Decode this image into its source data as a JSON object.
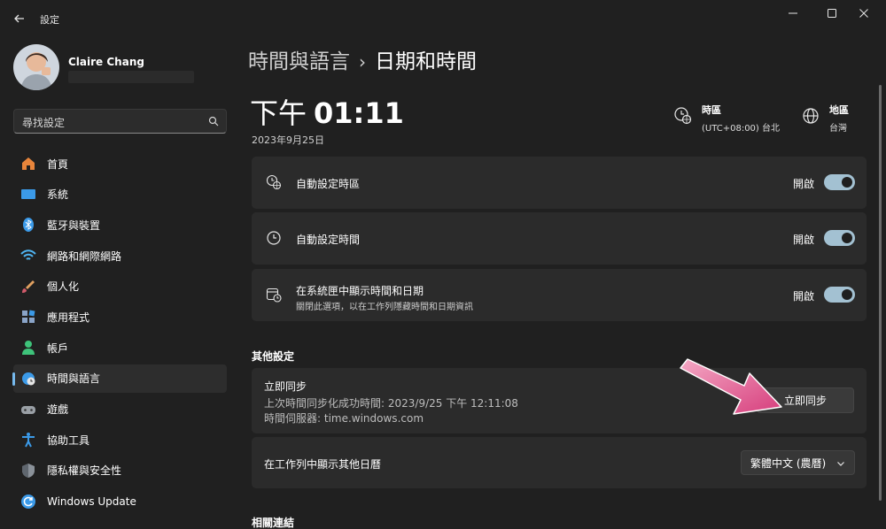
{
  "app": {
    "title": "設定"
  },
  "user": {
    "name": "Claire Chang"
  },
  "search": {
    "placeholder": "尋找設定"
  },
  "nav": [
    {
      "label": "首頁",
      "icon": "home-icon",
      "color": "#e8853b"
    },
    {
      "label": "系統",
      "icon": "monitor-icon",
      "color": "#3b9ae8"
    },
    {
      "label": "藍牙與裝置",
      "icon": "bluetooth-icon",
      "color": "#3b9ae8"
    },
    {
      "label": "網路和網際網路",
      "icon": "wifi-icon",
      "color": "#4fb3f0"
    },
    {
      "label": "個人化",
      "icon": "brush-icon",
      "color": "#e0a060"
    },
    {
      "label": "應用程式",
      "icon": "apps-icon",
      "color": "#8aa4c8"
    },
    {
      "label": "帳戶",
      "icon": "person-icon",
      "color": "#3ec37a"
    },
    {
      "label": "時間與語言",
      "icon": "globe-clock-icon",
      "color": "#3b9ae8",
      "active": true
    },
    {
      "label": "遊戲",
      "icon": "gamepad-icon",
      "color": "#9aa0a6"
    },
    {
      "label": "協助工具",
      "icon": "accessibility-icon",
      "color": "#3b9ae8"
    },
    {
      "label": "隱私權與安全性",
      "icon": "shield-icon",
      "color": "#8a9199"
    },
    {
      "label": "Windows Update",
      "icon": "update-icon",
      "color": "#3b9ae8"
    }
  ],
  "header": {
    "breadcrumb_parent": "時間與語言",
    "breadcrumb_sep": "›",
    "breadcrumb_current": "日期和時間"
  },
  "clock": {
    "ampm": "下午",
    "time": "01:11",
    "date": "2023年9月25日"
  },
  "timezone": {
    "title": "時區",
    "value": "(UTC+08:00) 台北"
  },
  "region": {
    "title": "地區",
    "value": "台灣"
  },
  "settings": {
    "auto_timezone": {
      "label": "自動設定時區",
      "state": "開啟"
    },
    "auto_time": {
      "label": "自動設定時間",
      "state": "開啟"
    },
    "tray_show": {
      "label": "在系統匣中顯示時間和日期",
      "sub": "關閉此選項，以在工作列隱藏時間和日期資訊",
      "state": "開啟"
    }
  },
  "other": {
    "section": "其他設定",
    "sync_title": "立即同步",
    "sync_last": "上次時間同步化成功時間: 2023/9/25 下午 12:11:08",
    "sync_server": "時間伺服器: time.windows.com",
    "sync_button": "立即同步",
    "calendar_label": "在工作列中顯示其他日曆",
    "calendar_value": "繁體中文 (農曆)"
  },
  "related": {
    "section": "相關連結"
  },
  "colors": {
    "accent": "#76b9ed",
    "toggle_on": "#a3c1d2",
    "arrow": "#e0508a"
  }
}
